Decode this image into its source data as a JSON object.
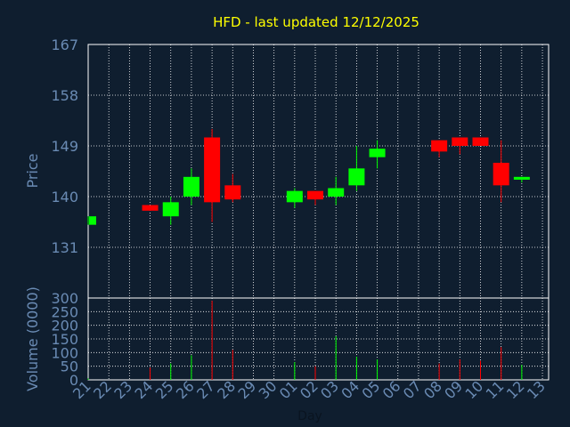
{
  "chart_data": [
    {
      "type": "candlestick",
      "title": "HFD - last updated 12/12/2025",
      "ylabel": "Price",
      "ylim": [
        122,
        167
      ],
      "y_ticks": [
        "167",
        "158",
        "149",
        "140",
        "131"
      ],
      "y_tick_values": [
        167,
        158,
        149,
        140,
        131
      ],
      "grid": true,
      "up_color": "#00ff00",
      "down_color": "#ff0000",
      "candles": [
        {
          "x": "21",
          "open": 135,
          "close": 136.5,
          "high": 136.5,
          "low": 135
        },
        {
          "x": "24",
          "open": 138.5,
          "close": 137.5,
          "high": 138.5,
          "low": 137.5
        },
        {
          "x": "25",
          "open": 136.5,
          "close": 139,
          "high": 140,
          "low": 135
        },
        {
          "x": "26",
          "open": 140,
          "close": 143.5,
          "high": 145,
          "low": 138.5
        },
        {
          "x": "27",
          "open": 150.5,
          "close": 139,
          "high": 152,
          "low": 135.5
        },
        {
          "x": "28",
          "open": 142,
          "close": 139.5,
          "high": 144,
          "low": 139
        },
        {
          "x": "01",
          "open": 139,
          "close": 141,
          "high": 141.5,
          "low": 138
        },
        {
          "x": "02",
          "open": 141,
          "close": 139.5,
          "high": 141,
          "low": 138.5
        },
        {
          "x": "03",
          "open": 140,
          "close": 141.5,
          "high": 143.5,
          "low": 138.5
        },
        {
          "x": "04",
          "open": 142,
          "close": 145,
          "high": 149,
          "low": 141
        },
        {
          "x": "05",
          "open": 147,
          "close": 148.5,
          "high": 150,
          "low": 145
        },
        {
          "x": "08",
          "open": 150,
          "close": 148,
          "high": 150,
          "low": 147
        },
        {
          "x": "09",
          "open": 150.5,
          "close": 149,
          "high": 150.5,
          "low": 147.5
        },
        {
          "x": "10",
          "open": 150.5,
          "close": 149,
          "high": 150.5,
          "low": 149
        },
        {
          "x": "11",
          "open": 146,
          "close": 142,
          "high": 150,
          "low": 139
        },
        {
          "x": "12",
          "open": 143,
          "close": 143.5,
          "high": 143.5,
          "low": 142.5
        }
      ]
    },
    {
      "type": "bar",
      "ylabel": "Volume (0000)",
      "xlabel": "Day",
      "ylim": [
        0,
        300
      ],
      "y_ticks": [
        "300",
        "250",
        "200",
        "150",
        "100",
        "50",
        "0"
      ],
      "y_tick_values": [
        300,
        250,
        200,
        150,
        100,
        50,
        0
      ],
      "x_ticks": [
        "21",
        "22",
        "23",
        "24",
        "25",
        "26",
        "27",
        "28",
        "29",
        "30",
        "01",
        "02",
        "03",
        "04",
        "05",
        "06",
        "07",
        "08",
        "09",
        "10",
        "11",
        "12",
        "13"
      ],
      "categories": [
        "21",
        "24",
        "25",
        "26",
        "27",
        "28",
        "01",
        "02",
        "03",
        "04",
        "05",
        "08",
        "09",
        "10",
        "11",
        "12"
      ],
      "values": [
        5,
        45,
        60,
        90,
        290,
        110,
        65,
        50,
        160,
        85,
        75,
        60,
        75,
        70,
        120,
        55
      ],
      "colors": [
        "#00ff00",
        "#ff0000",
        "#00ff00",
        "#00ff00",
        "#ff0000",
        "#ff0000",
        "#00ff00",
        "#ff0000",
        "#00ff00",
        "#00ff00",
        "#00ff00",
        "#ff0000",
        "#ff0000",
        "#ff0000",
        "#ff0000",
        "#00ff00"
      ]
    }
  ],
  "colors": {
    "background": "#0f1e2f",
    "plot_border": "#ffffff",
    "grid": "#ffffff",
    "title": "#ffff00",
    "axis_text": "#6a8bb4"
  }
}
